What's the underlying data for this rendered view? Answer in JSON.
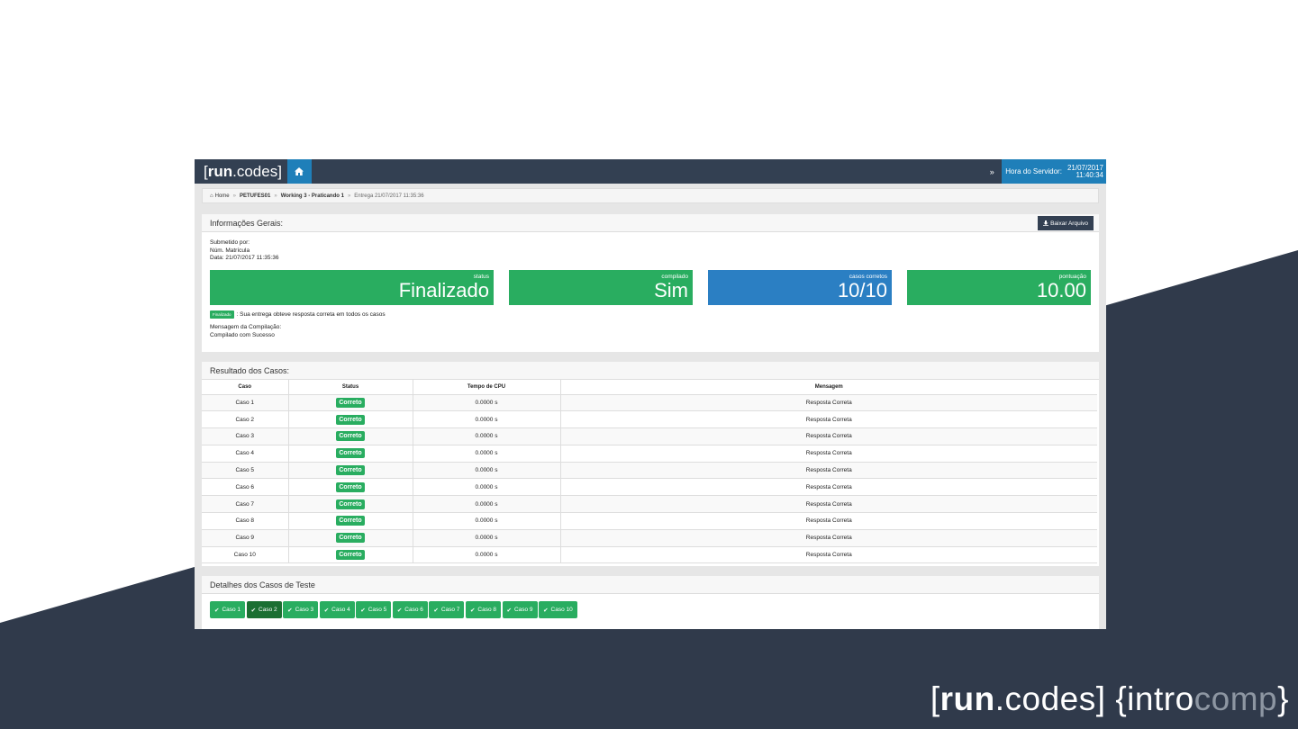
{
  "colors": {
    "dark": "#303a4b",
    "accent_blue": "#1f7fb9",
    "success_green": "#29ad60"
  },
  "navbar": {
    "brand_bracket_open": "[",
    "brand_bold": "run",
    "brand_rest": ".codes]",
    "home_icon": "home-icon",
    "chevron": "»",
    "server_label": "Hora do Servidor:",
    "server_date": "21/07/2017",
    "server_time": "11:40:34"
  },
  "breadcrumb": {
    "home": "Home",
    "item1": "PETUFES01",
    "item2": "Working 3 - Praticando 1",
    "item3": "Entrega 21/07/2017 11:35:36",
    "sep": "»"
  },
  "info_panel": {
    "title": "Informações Gerais:",
    "download_label": "Baixar Arquivo",
    "submitted_by": "Submetido por:",
    "matricula": "Núm. Matrícula",
    "date": "Data: 21/07/2017 11:35:36",
    "stats": [
      {
        "label": "status",
        "value": "Finalizado"
      },
      {
        "label": "compilado",
        "value": "Sim"
      },
      {
        "label": "casos corretos",
        "value": "10/10"
      },
      {
        "label": "pontuação",
        "value": "10.00"
      }
    ],
    "badge": "Finalizado",
    "note": ": Sua entrega obteve resposta correta em todos os casos",
    "compile_label": "Mensagem da Compilação:",
    "compile_msg": "Compilado com Sucesso"
  },
  "results_panel": {
    "title": "Resultado dos Casos:",
    "headers": [
      "Caso",
      "Status",
      "Tempo de CPU",
      "Mensagem"
    ],
    "rows": [
      {
        "caso": "Caso 1",
        "status": "Correto",
        "cpu": "0.0000 s",
        "msg": "Resposta Correta"
      },
      {
        "caso": "Caso 2",
        "status": "Correto",
        "cpu": "0.0000 s",
        "msg": "Resposta Correta"
      },
      {
        "caso": "Caso 3",
        "status": "Correto",
        "cpu": "0.0000 s",
        "msg": "Resposta Correta"
      },
      {
        "caso": "Caso 4",
        "status": "Correto",
        "cpu": "0.0000 s",
        "msg": "Resposta Correta"
      },
      {
        "caso": "Caso 5",
        "status": "Correto",
        "cpu": "0.0000 s",
        "msg": "Resposta Correta"
      },
      {
        "caso": "Caso 6",
        "status": "Correto",
        "cpu": "0.0000 s",
        "msg": "Resposta Correta"
      },
      {
        "caso": "Caso 7",
        "status": "Correto",
        "cpu": "0.0000 s",
        "msg": "Resposta Correta"
      },
      {
        "caso": "Caso 8",
        "status": "Correto",
        "cpu": "0.0000 s",
        "msg": "Resposta Correta"
      },
      {
        "caso": "Caso 9",
        "status": "Correto",
        "cpu": "0.0000 s",
        "msg": "Resposta Correta"
      },
      {
        "caso": "Caso 10",
        "status": "Correto",
        "cpu": "0.0000 s",
        "msg": "Resposta Correta"
      }
    ]
  },
  "details_panel": {
    "title": "Detalhes dos Casos de Teste",
    "buttons": [
      "Caso 1",
      "Caso 2",
      "Caso 3",
      "Caso 4",
      "Caso 5",
      "Caso 6",
      "Caso 7",
      "Caso 8",
      "Caso 9",
      "Caso 10"
    ],
    "active_button": "Caso 2"
  },
  "footer_logo": {
    "open": "[",
    "bold": "run",
    "rest": ".codes] ",
    "brace_open": "{",
    "intro": "intro",
    "comp": "comp",
    "brace_close": "}"
  }
}
